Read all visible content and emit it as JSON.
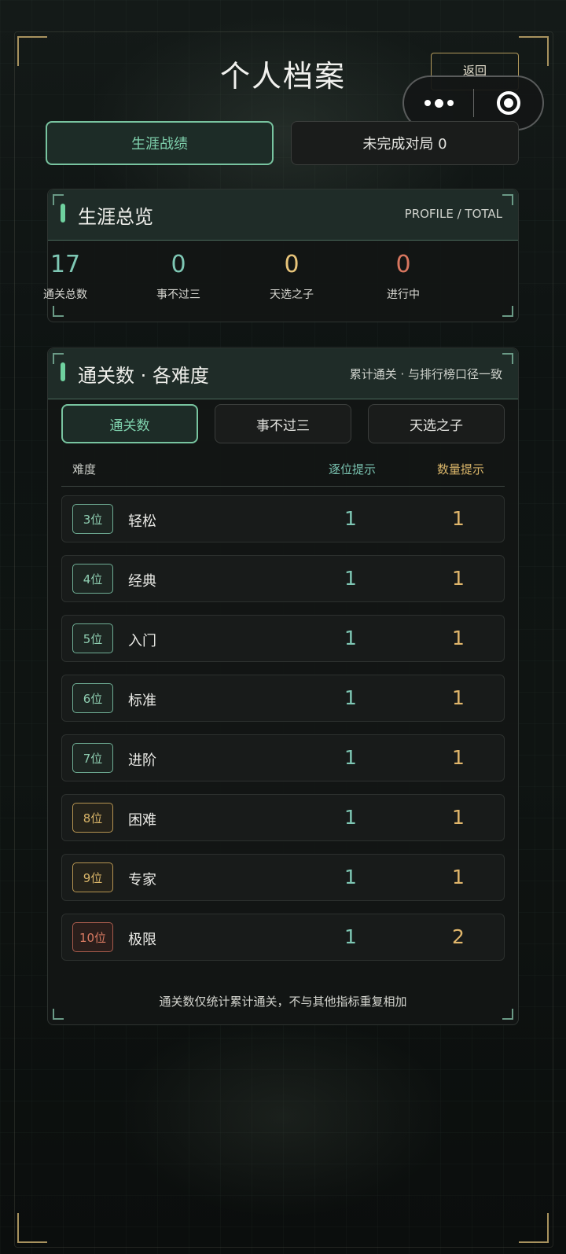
{
  "header": {
    "title": "个人档案",
    "back_label": "返回"
  },
  "top_tabs": [
    {
      "label": "生涯战绩",
      "active": true
    },
    {
      "label": "未完成对局 0",
      "active": false
    }
  ],
  "overview": {
    "title": "生涯总览",
    "subtitle": "PROFILE / TOTAL",
    "stats": [
      {
        "value": "17",
        "label": "通关总数",
        "color": "#7ec7b4"
      },
      {
        "value": "0",
        "label": "事不过三",
        "color": "#7ec7b4"
      },
      {
        "value": "0",
        "label": "天选之子",
        "color": "#e7c47a"
      },
      {
        "value": "0",
        "label": "进行中",
        "color": "#d8765f"
      }
    ]
  },
  "clears": {
    "title": "通关数 · 各难度",
    "subtitle": "累计通关 · 与排行榜口径一致",
    "segments": [
      {
        "label": "通关数",
        "active": true
      },
      {
        "label": "事不过三",
        "active": false
      },
      {
        "label": "天选之子",
        "active": false
      }
    ],
    "columns": {
      "difficulty": "难度",
      "position_hint": "逐位提示",
      "count_hint": "数量提示"
    },
    "rows": [
      {
        "badge": "3位",
        "name": "轻松",
        "position_hint": "1",
        "count_hint": "1",
        "tone": "green"
      },
      {
        "badge": "4位",
        "name": "经典",
        "position_hint": "1",
        "count_hint": "1",
        "tone": "green"
      },
      {
        "badge": "5位",
        "name": "入门",
        "position_hint": "1",
        "count_hint": "1",
        "tone": "green"
      },
      {
        "badge": "6位",
        "name": "标准",
        "position_hint": "1",
        "count_hint": "1",
        "tone": "green"
      },
      {
        "badge": "7位",
        "name": "进阶",
        "position_hint": "1",
        "count_hint": "1",
        "tone": "green"
      },
      {
        "badge": "8位",
        "name": "困难",
        "position_hint": "1",
        "count_hint": "1",
        "tone": "gold"
      },
      {
        "badge": "9位",
        "name": "专家",
        "position_hint": "1",
        "count_hint": "1",
        "tone": "gold"
      },
      {
        "badge": "10位",
        "name": "极限",
        "position_hint": "1",
        "count_hint": "2",
        "tone": "red"
      }
    ],
    "footnote": "通关数仅统计累计通关，不与其他指标重复相加"
  },
  "icons": {
    "more": "more-dots-icon",
    "close": "target-circle-icon"
  },
  "colors": {
    "accent": "#78c4a0",
    "gold": "#d9b569",
    "danger": "#d8765f"
  }
}
